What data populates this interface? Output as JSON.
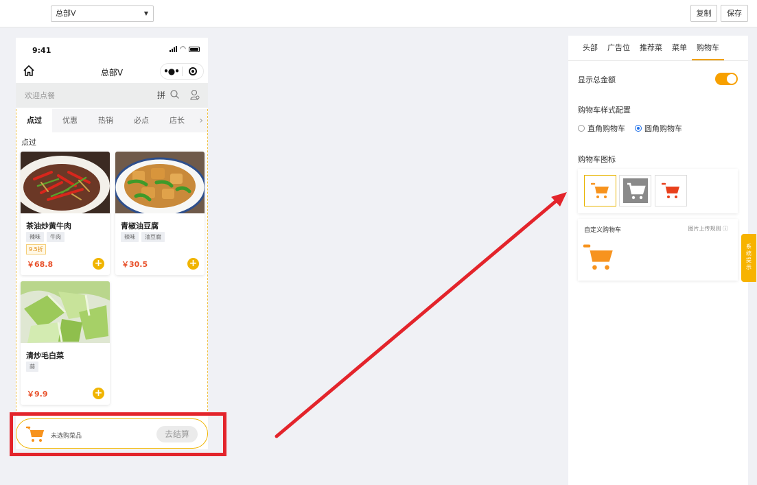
{
  "topbar": {
    "store_select_value": "总部V",
    "copy_label": "复制",
    "save_label": "保存"
  },
  "phone": {
    "time": "9:41",
    "nav_title": "总部V",
    "search_placeholder": "欢迎点餐",
    "pinyin_label": "拼",
    "tabs": [
      "点过",
      "优惠",
      "热销",
      "必点",
      "店长"
    ],
    "category_title": "点过",
    "products": [
      {
        "name": "茶油炒黄牛肉",
        "tags": [
          "辣味",
          "牛肉"
        ],
        "discount": "9.5折",
        "price": "￥68.8"
      },
      {
        "name": "青椒油豆腐",
        "tags": [
          "辣味",
          "油豆腐"
        ],
        "discount": "",
        "price": "￥30.5"
      },
      {
        "name": "清炒毛白菜",
        "tags": [
          "蒜"
        ],
        "discount": "",
        "price": "￥9.9"
      }
    ],
    "cart_text": "未选购菜品",
    "checkout_label": "去结算"
  },
  "panel": {
    "tabs": [
      "头部",
      "广告位",
      "推荐菜",
      "菜单",
      "购物车"
    ],
    "active_tab": "购物车",
    "show_total_label": "显示总金额",
    "show_total_on": true,
    "style_label": "购物车样式配置",
    "style_options": [
      "直角购物车",
      "圆角购物车"
    ],
    "style_selected": "圆角购物车",
    "icon_label": "购物车图标",
    "cart_icons": [
      "cart-icon-orange",
      "cart-icon-gray-box",
      "cart-icon-red"
    ],
    "custom_title": "自定义购物车",
    "upload_rule": "图片上传规则"
  },
  "side_tab": {
    "chars": [
      "系",
      "统",
      "提",
      "示"
    ]
  },
  "colors": {
    "accent": "#f7a000",
    "price": "#e8512b",
    "annotation": "#e3242b"
  }
}
